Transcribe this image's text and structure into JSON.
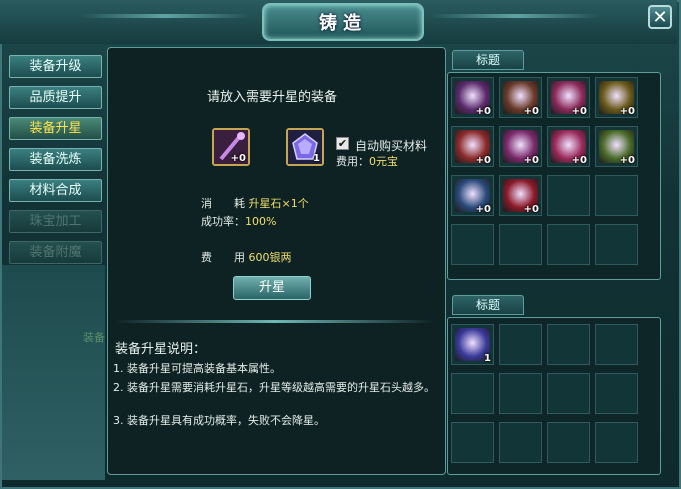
{
  "window": {
    "title": "铸造",
    "close_label": "✕"
  },
  "tabs": [
    {
      "label": "装备升级",
      "state": "normal"
    },
    {
      "label": "品质提升",
      "state": "normal"
    },
    {
      "label": "装备升星",
      "state": "active"
    },
    {
      "label": "装备洗炼",
      "state": "normal"
    },
    {
      "label": "材料合成",
      "state": "normal"
    },
    {
      "label": "珠宝加工",
      "state": "disabled"
    },
    {
      "label": "装备附魔",
      "state": "disabled"
    }
  ],
  "center": {
    "prompt": "请放入需要升星的装备",
    "equip_slot": {
      "icon": "staff-icon",
      "qty": "+0"
    },
    "material_slot": {
      "icon": "star-stone-icon",
      "qty": "1"
    },
    "auto_buy": {
      "checked": true,
      "label": "自动购买材料"
    },
    "fee_gold_label": "费用：",
    "fee_gold_value": "0元宝",
    "consume_label": "消　　耗",
    "consume_value": "升星石×1个",
    "success_label": "成功率：",
    "success_value": "100%",
    "cost_label": "费　　用",
    "cost_value": "600银两",
    "action_button": "升星",
    "desc_title": "装备升星说明：",
    "desc_items": [
      "1. 装备升星可提高装备基本属性。",
      "2. 装备升星需要消耗升星石，升星等级越高需要的升星石头越多。",
      "3. 装备升星具有成功概率，失败不会降星。"
    ]
  },
  "side_text": "装备",
  "equipment_panel": {
    "label": "标题",
    "items": [
      {
        "icon": "staff-icon",
        "qty": "+0",
        "color": "#5a2a6a"
      },
      {
        "icon": "necklace-icon",
        "qty": "+0",
        "color": "#6a3a2a"
      },
      {
        "icon": "helmet-icon",
        "qty": "+0",
        "color": "#8a2a5a"
      },
      {
        "icon": "ring-icon",
        "qty": "+0",
        "color": "#6a5a1a"
      },
      {
        "icon": "shoulder-armor-icon",
        "qty": "+0",
        "color": "#8a2a2a"
      },
      {
        "icon": "chest-armor-icon",
        "qty": "+0",
        "color": "#7a2a6a"
      },
      {
        "icon": "gauntlet-icon",
        "qty": "+0",
        "color": "#9a2a5a"
      },
      {
        "icon": "robe-icon",
        "qty": "+0",
        "color": "#4a6a2a"
      },
      {
        "icon": "belt-icon",
        "qty": "+0",
        "color": "#2a4a7a"
      },
      {
        "icon": "boots-icon",
        "qty": "+0",
        "color": "#8a1a2a"
      },
      null,
      null,
      null,
      null,
      null,
      null
    ]
  },
  "material_panel": {
    "label": "标题",
    "items": [
      {
        "icon": "star-stone-icon",
        "qty": "1",
        "color": "#3a3a9a"
      },
      null,
      null,
      null,
      null,
      null,
      null,
      null,
      null,
      null,
      null,
      null
    ]
  }
}
